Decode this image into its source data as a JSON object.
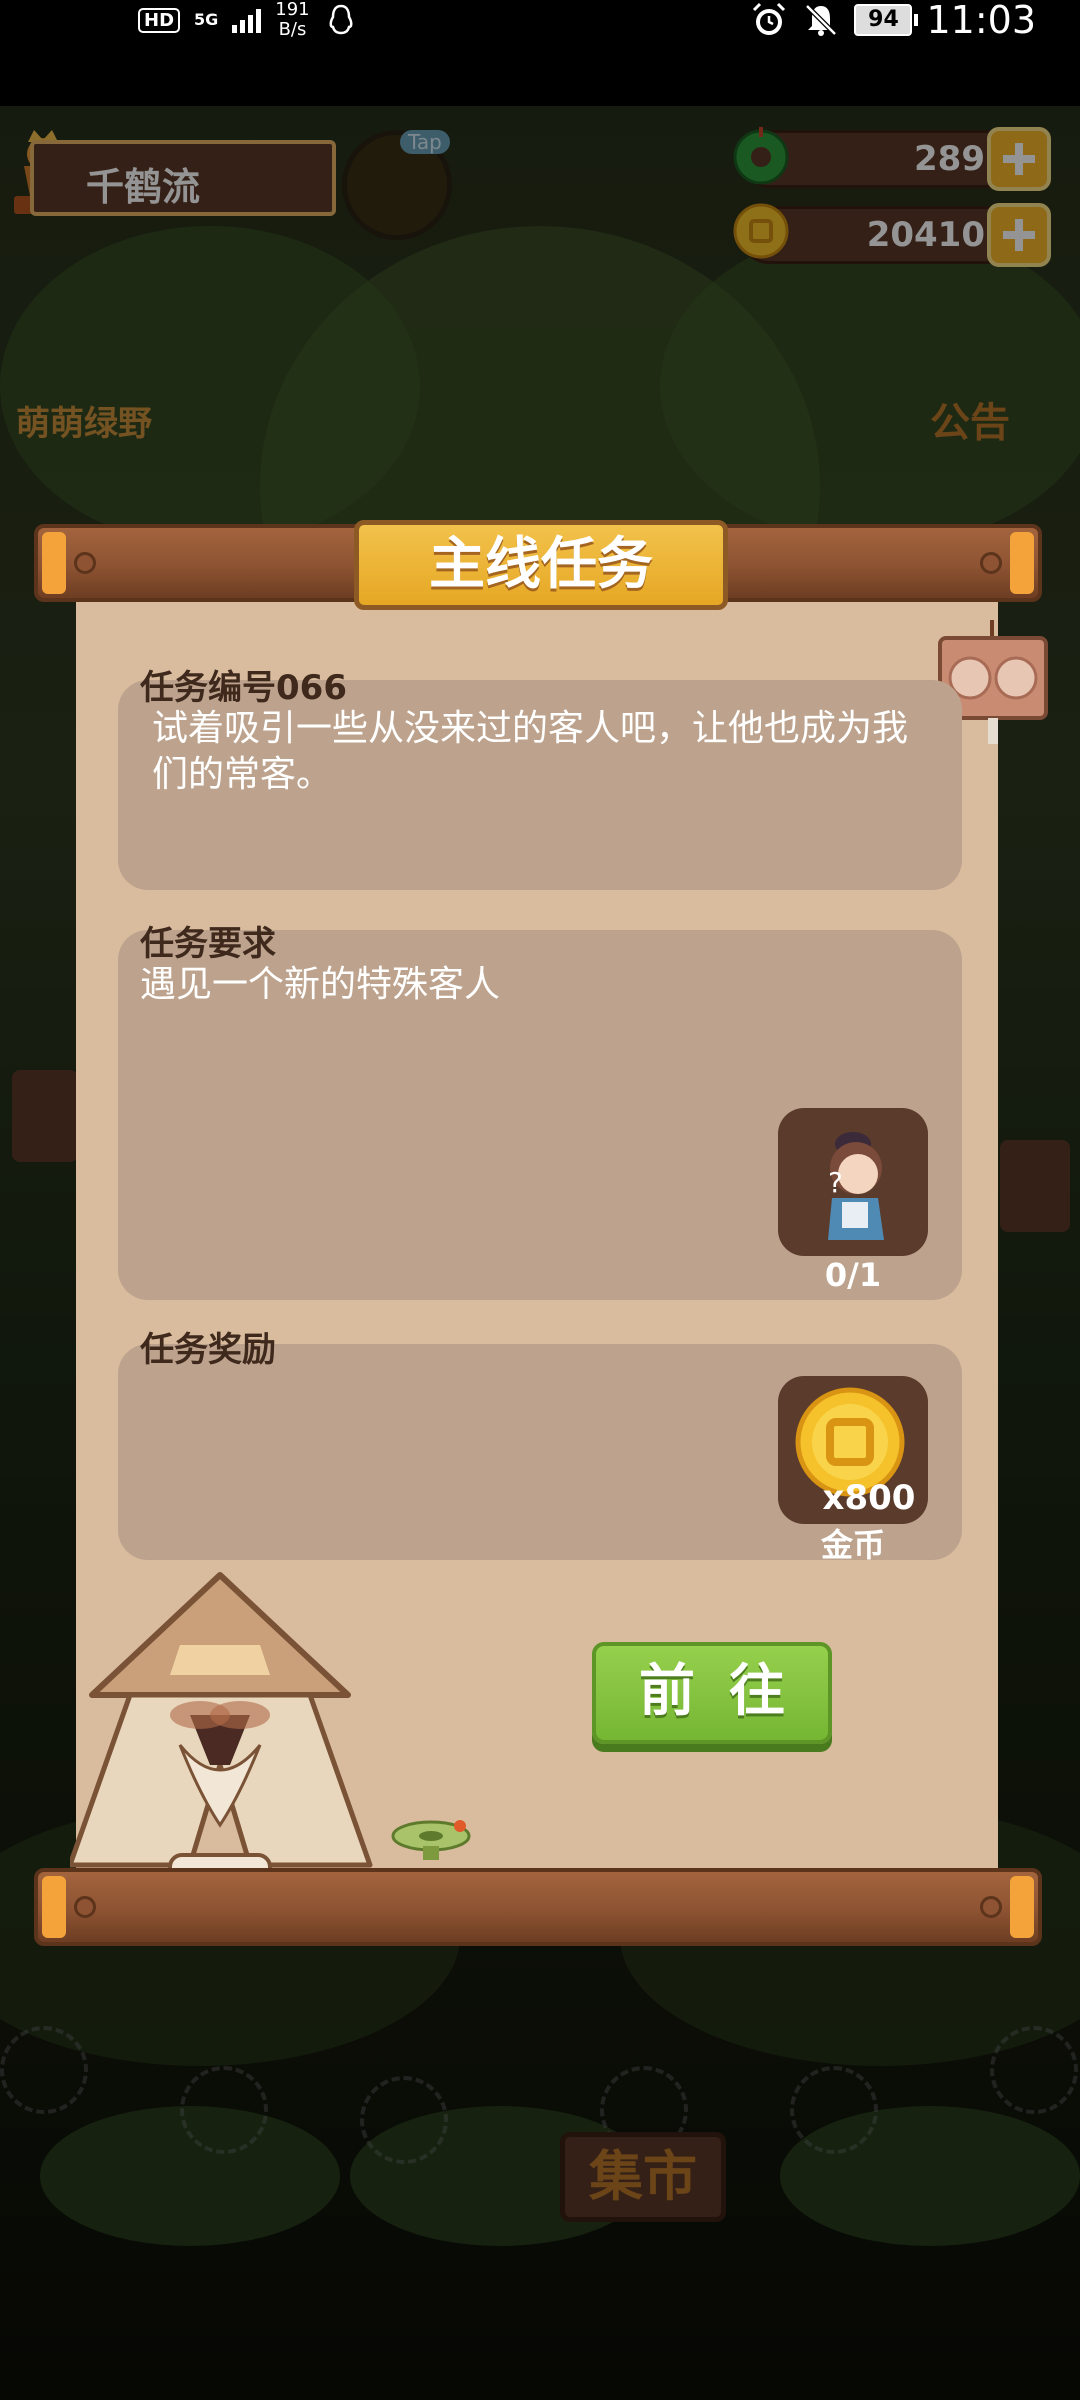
{
  "status_bar": {
    "hd": "HD",
    "network": "5G",
    "speed_value": "191",
    "speed_unit": "B/s",
    "battery": "94",
    "time": "11:03"
  },
  "hud": {
    "player_name": "千鹤流",
    "tap_label": "Tap",
    "jade_amount": "289",
    "coin_amount": "20410"
  },
  "background_labels": {
    "left_area": "萌萌绿野",
    "notice": "公告",
    "market": "集市"
  },
  "dialog": {
    "title": "主线任务",
    "task_number_label": "任务编号066",
    "task_description": "试着吸引一些从没来过的客人吧，让他也成为我们的常客。",
    "requirement_label": "任务要求",
    "requirement_text": "遇见一个新的特殊客人",
    "requirement_progress": "0/1",
    "reward_label": "任务奖励",
    "reward_amount": "x800",
    "reward_name": "金币",
    "go_button": "前往"
  },
  "colors": {
    "panel": "#d9bc9d",
    "section": "#bda38d",
    "plank": "#8d5332",
    "banner": "#e6a724",
    "button": "#75b633"
  }
}
